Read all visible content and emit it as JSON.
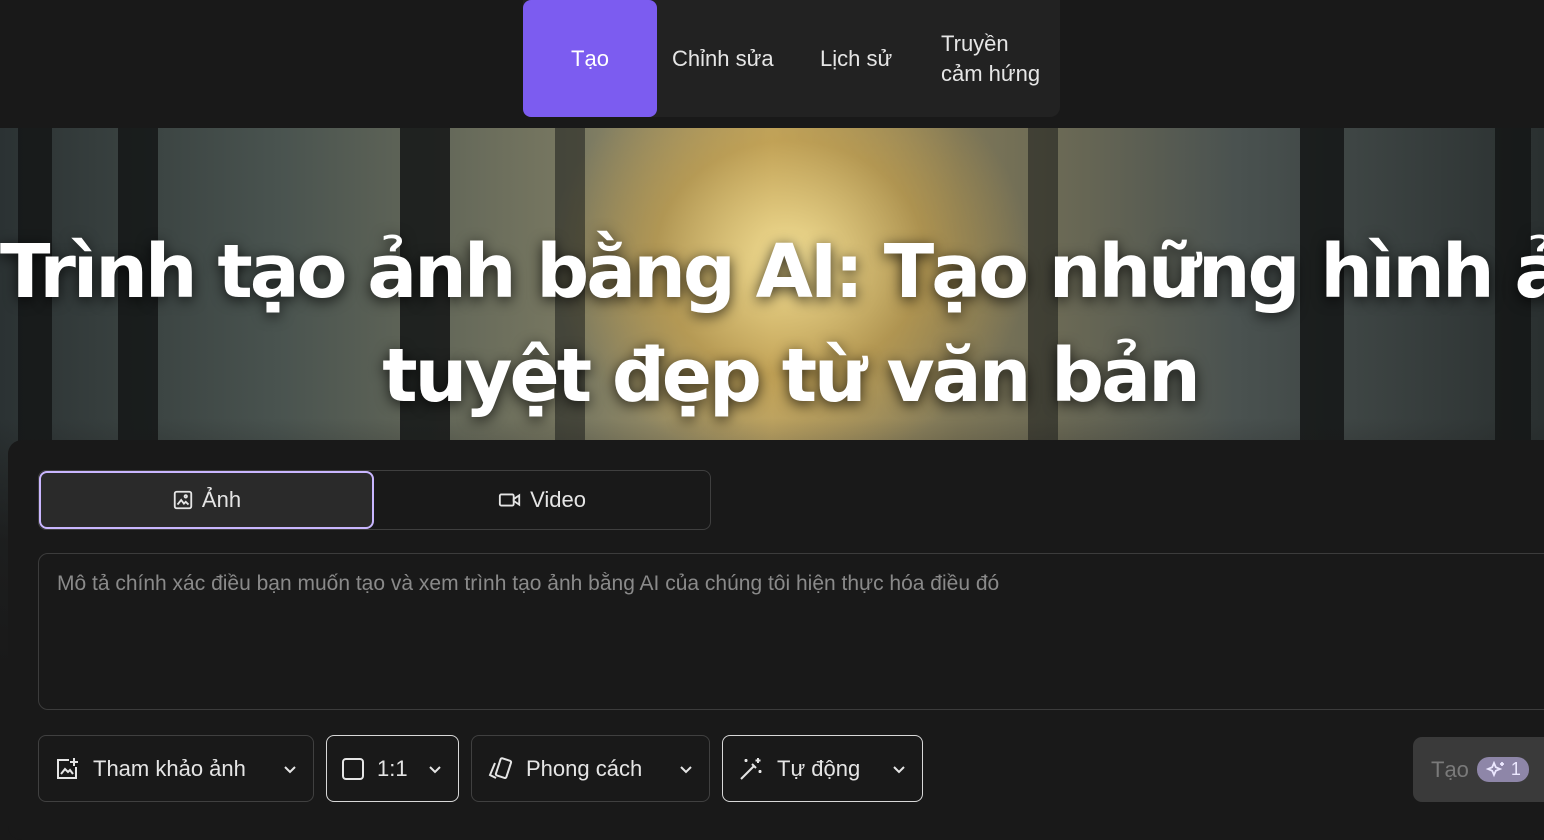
{
  "nav": {
    "items": [
      {
        "label": "Tạo",
        "active": true
      },
      {
        "label": "Chỉnh sửa"
      },
      {
        "label": "Lịch sử"
      },
      {
        "label": "Truyền cảm hứng"
      }
    ]
  },
  "hero": {
    "title_line1": "Trình tạo ảnh bằng AI: Tạo những hình ảnh",
    "title_line2": "tuyệt đẹp từ văn bản"
  },
  "mode": {
    "photo_label": "Ảnh",
    "video_label": "Video",
    "selected": "photo"
  },
  "prompt": {
    "placeholder": "Mô tả chính xác điều bạn muốn tạo và xem trình tạo ảnh bằng AI của chúng tôi hiện thực hóa điều đó",
    "value": ""
  },
  "controls": {
    "reference_label": "Tham khảo ảnh",
    "ratio_label": "1:1",
    "style_label": "Phong cách",
    "auto_label": "Tự động"
  },
  "generate": {
    "label": "Tạo",
    "credits": "1",
    "disabled": true
  },
  "colors": {
    "accent": "#7c5cf0",
    "selected_border": "#c9b6ff",
    "background": "#191919"
  }
}
